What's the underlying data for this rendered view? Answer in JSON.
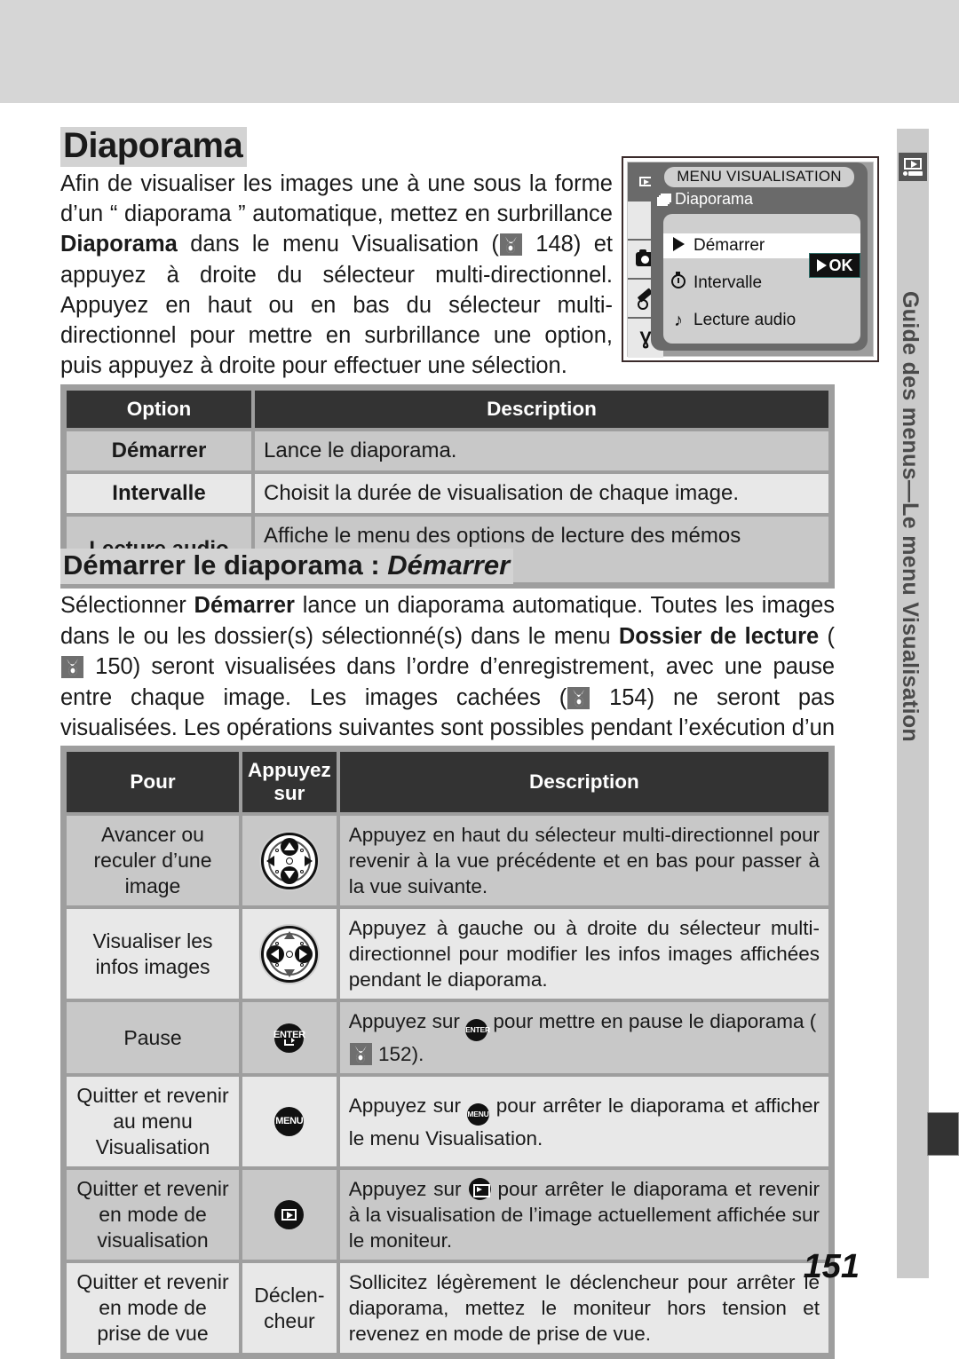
{
  "page": {
    "number": "151",
    "side_tab_label": "Guide des menus—Le menu Visualisation"
  },
  "section": {
    "title": "Diaporama",
    "intro_parts": {
      "p1": "Afin de visualiser les images une à une sous la forme d’un “ diaporama ” automatique, mettez en surbrillance ",
      "bold1": "Diaporama",
      "p2": " dans le menu Visualisation (",
      "ref1": "148",
      "p3": ") et appuyez à droite du sélecteur multi-directionnel. Appuyez en haut ou en bas du sélecteur multi-directionnel pour mettre en surbrillance une option, puis appuyez à droite pour effectuer une sélection."
    }
  },
  "lcd": {
    "title": "MENU VISUALISATION",
    "subtitle": "Diaporama",
    "items": [
      {
        "icon": "arrow-right-icon",
        "label": "Démarrer",
        "selected": true,
        "ok_label": "OK"
      },
      {
        "icon": "clock-icon",
        "label": "Intervalle",
        "selected": false
      },
      {
        "icon": "music-note-icon",
        "label": "Lecture audio",
        "selected": false
      }
    ],
    "sidebar_icons": [
      "playback-icon",
      "camera-icon",
      "pencil-icon",
      "wrench-icon"
    ]
  },
  "table_options": {
    "headers": [
      "Option",
      "Description"
    ],
    "rows": [
      {
        "option": "Démarrer",
        "description": "Lance le diaporama."
      },
      {
        "option": "Intervalle",
        "description": "Choisit la durée de visualisation de chaque image."
      },
      {
        "option": "Lecture audio",
        "description": "Affiche le menu des options de lecture des mémos vocaux."
      }
    ]
  },
  "subsection": {
    "title_plain": "Démarrer le diaporama : ",
    "title_italic": "Démarrer",
    "body_parts": {
      "b1": "Sélectionner ",
      "bold1": "Démarrer",
      "b2": " lance un diaporama automatique. Toutes les images dans le ou les dossier(s) sélectionné(s) dans le menu ",
      "bold2": "Dossier de lecture",
      "b3": " (",
      "ref1": "150",
      "b4": ") seront visualisées dans l’ordre d’enregistrement, avec une pause entre chaque image. Les images cachées (",
      "ref2": "154",
      "b5": ") ne seront pas visualisées. Les opérations suivantes sont possibles pendant l’exécution d’un diaporama :"
    }
  },
  "table_ops": {
    "headers": [
      "Pour",
      "Appuyez sur",
      "Description"
    ],
    "header_press_line1": "Appuyez",
    "header_press_line2": "sur",
    "rows": [
      {
        "pour": "Avancer ou reculer d’une image",
        "press_icon": "multi-selector-updown-icon",
        "press_text": "",
        "description": "Appuyez en haut du sélecteur multi-directionnel pour revenir à la vue précédente et en bas pour passer à la vue suivante."
      },
      {
        "pour": "Visualiser les infos images",
        "press_icon": "multi-selector-leftright-icon",
        "press_text": "",
        "description": "Appuyez à gauche ou à droite du sélecteur multi-directionnel pour modifier les infos images affichées pendant le diaporama."
      },
      {
        "pour": "Pause",
        "press_icon": "enter-button-icon",
        "press_text": "ENTER",
        "desc_pre": "Appuyez sur ",
        "desc_mid": " pour mettre en pause le diaporama (",
        "desc_ref": "152",
        "desc_post": ")."
      },
      {
        "pour": "Quitter et revenir au menu Visualisation",
        "press_icon": "menu-button-icon",
        "press_text": "MENU",
        "desc_pre": "Appuyez sur ",
        "desc_post": " pour arrêter le diaporama et afficher le menu Visualisation."
      },
      {
        "pour": "Quitter et revenir en mode de visualisation",
        "press_icon": "playback-button-icon",
        "press_text": "",
        "desc_pre": "Appuyez sur ",
        "desc_post": " pour arrêter le diaporama et revenir à la visualisation de l’image actuellement affichée sur le moniteur."
      },
      {
        "pour": "Quitter et revenir en mode de prise de vue",
        "press_icon": "",
        "press_text": "Déclen-cheur",
        "press_text_line1": "Déclen-",
        "press_text_line2": "cheur",
        "description": "Sollicitez légèrement le déclencheur pour arrêter le diaporama, mettez le moniteur hors tension et revenez en mode de prise de vue."
      }
    ]
  }
}
